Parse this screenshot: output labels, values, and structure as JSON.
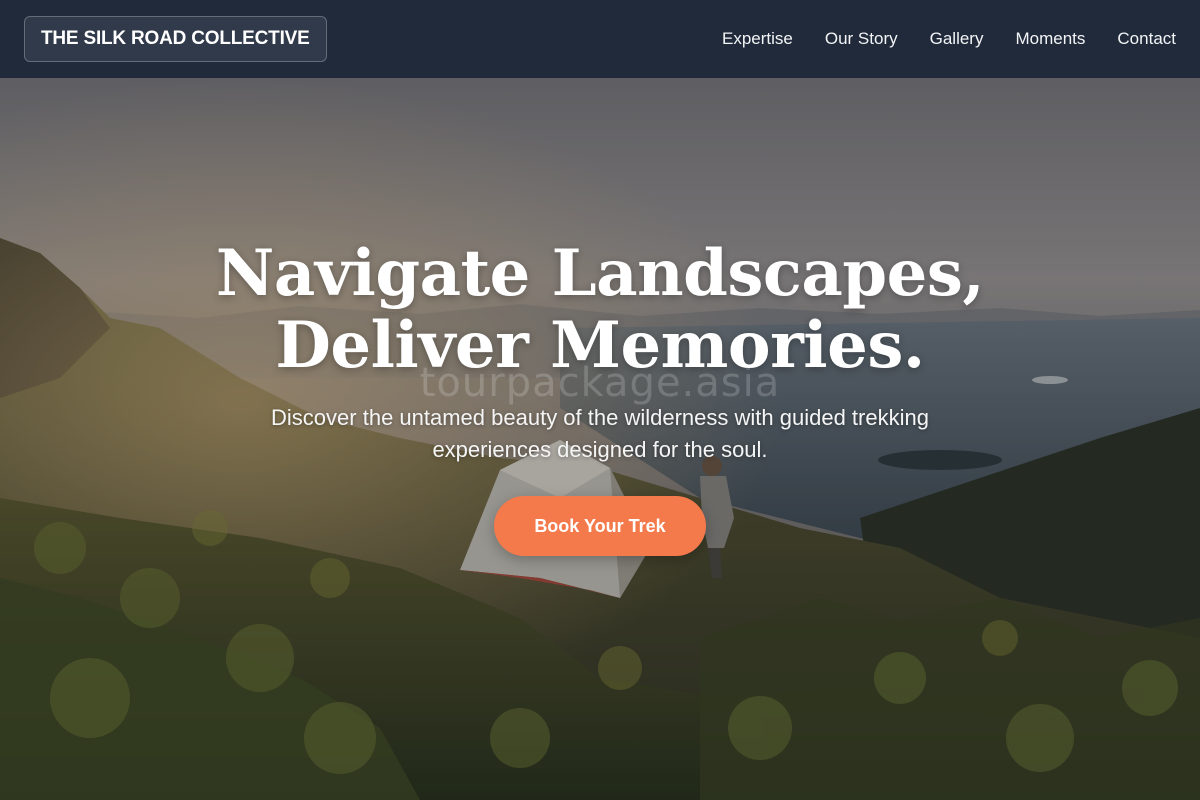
{
  "brand": {
    "name": "THE SILK ROAD COLLECTIVE"
  },
  "nav": {
    "items": [
      {
        "label": "Expertise"
      },
      {
        "label": "Our Story"
      },
      {
        "label": "Gallery"
      },
      {
        "label": "Moments"
      },
      {
        "label": "Contact"
      }
    ]
  },
  "hero": {
    "headline_line1": "Navigate Landscapes,",
    "headline_line2": "Deliver Memories.",
    "subtext": "Discover the untamed beauty of the wilderness with guided trekking experiences designed for the soul.",
    "cta_label": "Book Your Trek",
    "watermark": "tourpackage.asia"
  },
  "colors": {
    "header_bg": "#202a3b",
    "cta_bg": "#f47a4c",
    "text": "#ffffff"
  }
}
